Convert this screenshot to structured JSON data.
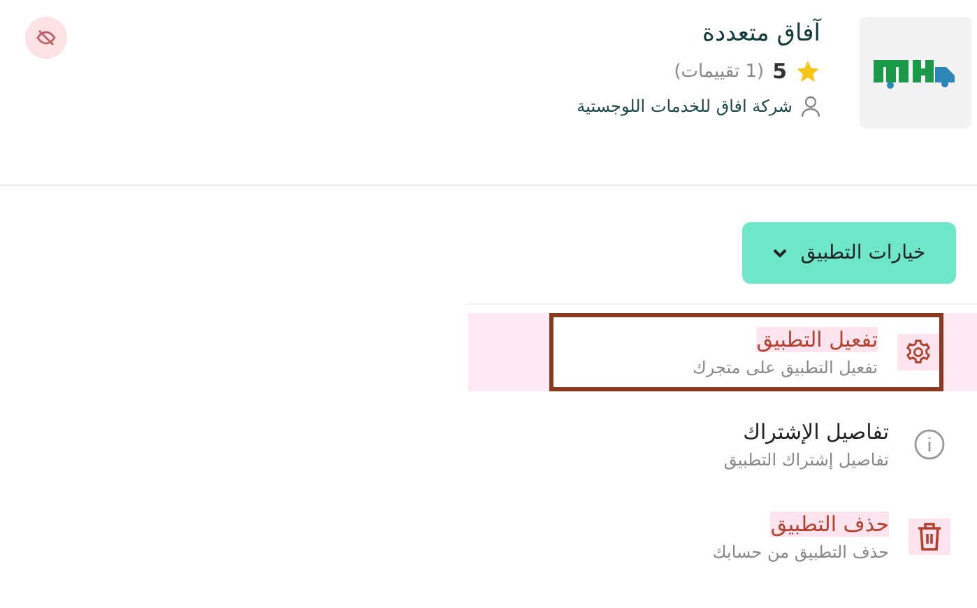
{
  "app": {
    "name": "آفاق متعددة",
    "rating": "5",
    "ratings_count": "(1 تقييمات)",
    "publisher": "شركة افاق للخدمات اللوجستية"
  },
  "options_button": {
    "label": "خيارات التطبيق"
  },
  "menu": [
    {
      "kind": "settings",
      "title": "تفعيل التطبيق",
      "subtitle": "تفعيل التطبيق على متجرك",
      "danger": true,
      "selected": true
    },
    {
      "kind": "info",
      "title": "تفاصيل الإشتراك",
      "subtitle": "تفاصيل إشتراك التطبيق",
      "danger": false,
      "selected": false
    },
    {
      "kind": "delete",
      "title": "حذف التطبيق",
      "subtitle": "حذف التطبيق من حسابك",
      "danger": true,
      "selected": false
    }
  ]
}
